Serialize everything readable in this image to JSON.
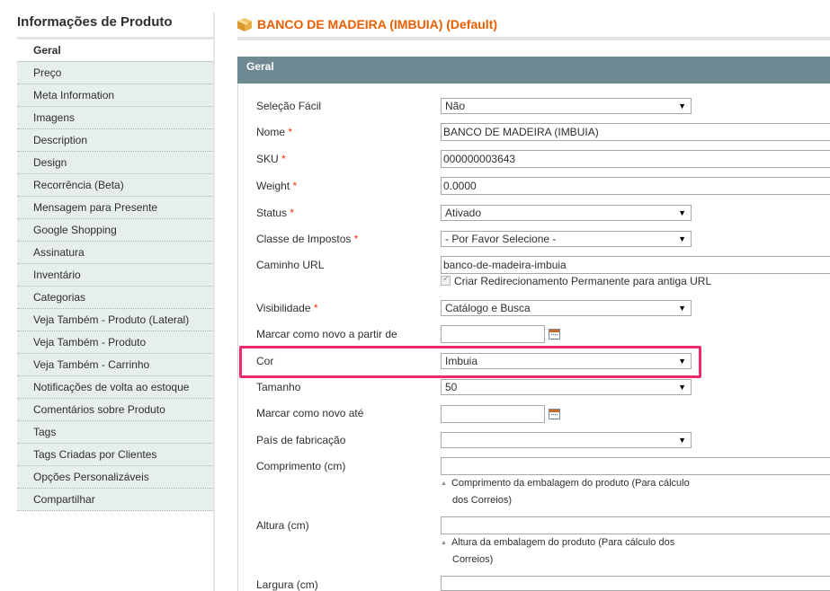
{
  "sidebar": {
    "title": "Informações de Produto",
    "items": [
      {
        "label": "Geral",
        "active": true
      },
      {
        "label": "Preço"
      },
      {
        "label": "Meta Information"
      },
      {
        "label": "Imagens"
      },
      {
        "label": "Description"
      },
      {
        "label": "Design"
      },
      {
        "label": "Recorrência (Beta)"
      },
      {
        "label": "Mensagem para Presente"
      },
      {
        "label": "Google Shopping"
      },
      {
        "label": "Assinatura"
      },
      {
        "label": "Inventário"
      },
      {
        "label": "Categorias"
      },
      {
        "label": "Veja Também - Produto (Lateral)"
      },
      {
        "label": "Veja Também - Produto"
      },
      {
        "label": "Veja Também - Carrinho"
      },
      {
        "label": "Notificações de volta ao estoque"
      },
      {
        "label": "Comentários sobre Produto"
      },
      {
        "label": "Tags"
      },
      {
        "label": "Tags Criadas por Clientes"
      },
      {
        "label": "Opções Personalizáveis"
      },
      {
        "label": "Compartilhar"
      }
    ]
  },
  "header": {
    "icon": "box-icon",
    "title": "BANCO DE MADEIRA (IMBUIA) (Default)"
  },
  "section": {
    "title": "Geral"
  },
  "form": {
    "selecao_facil": {
      "label": "Seleção Fácil",
      "value": "Não"
    },
    "nome": {
      "label": "Nome",
      "required": "*",
      "value": "BANCO DE MADEIRA (IMBUIA)"
    },
    "sku": {
      "label": "SKU",
      "required": "*",
      "value": "000000003643"
    },
    "weight": {
      "label": "Weight",
      "required": "*",
      "value": "0.0000"
    },
    "status": {
      "label": "Status",
      "required": "*",
      "value": "Ativado"
    },
    "classe_impostos": {
      "label": "Classe de Impostos",
      "required": "*",
      "value": "- Por Favor Selecione -"
    },
    "caminho_url": {
      "label": "Caminho URL",
      "value": "banco-de-madeira-imbuia",
      "checkbox_label": "Criar Redirecionamento Permanente para antiga URL",
      "checkbox_checked": true
    },
    "visibilidade": {
      "label": "Visibilidade",
      "required": "*",
      "value": "Catálogo e Busca"
    },
    "novo_de": {
      "label": "Marcar como novo a partir de",
      "value": ""
    },
    "cor": {
      "label": "Cor",
      "value": "Imbuia"
    },
    "tamanho": {
      "label": "Tamanho",
      "value": "50"
    },
    "novo_ate": {
      "label": "Marcar como novo até",
      "value": ""
    },
    "pais": {
      "label": "País de fabricação",
      "value": ""
    },
    "comprimento": {
      "label": "Comprimento (cm)",
      "value": "",
      "note_line1": "Comprimento da embalagem do produto (Para cálculo",
      "note_line2": "dos Correios)"
    },
    "altura": {
      "label": "Altura (cm)",
      "value": "",
      "note_line1": "Altura da embalagem do produto (Para cálculo dos",
      "note_line2": "Correios)"
    },
    "largura": {
      "label": "Largura (cm)",
      "value": ""
    }
  },
  "colors": {
    "accent_title": "#eb5e00",
    "section_header": "#6f8992",
    "sidebar_bg": "#e6efed",
    "highlight": "#eb2a6f",
    "required": "#eb340a"
  }
}
